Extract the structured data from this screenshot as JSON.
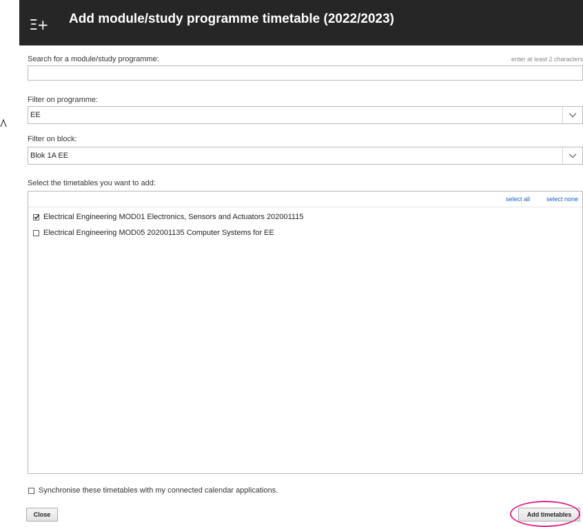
{
  "dialog": {
    "icon": "add-list-icon",
    "icon_glyph": "Ξ+",
    "title": "Add module/study programme timetable (2022/2023)"
  },
  "search": {
    "label": "Search for a module/study programme:",
    "hint": "enter at least 2 characters",
    "value": "",
    "placeholder": ""
  },
  "programme_filter": {
    "label": "Filter on programme:",
    "selected": "EE"
  },
  "block_filter": {
    "label": "Filter on block:",
    "selected": "Blok 1A EE"
  },
  "timetables": {
    "label": "Select the timetables you want to add:",
    "select_all": "select all",
    "select_none": "select none",
    "items": [
      {
        "label": "Electrical Engineering MOD01 Electronics, Sensors and Actuators 202001115",
        "checked": true
      },
      {
        "label": "Electrical Engineering MOD05 202001135 Computer Systems for EE",
        "checked": false
      }
    ]
  },
  "sync": {
    "label": "Synchronise these timetables with my connected calendar applications.",
    "checked": false
  },
  "buttons": {
    "close": "Close",
    "add": "Add timetables"
  },
  "colors": {
    "titlebar_bg": "#262626",
    "link": "#1a63b5",
    "highlight": "#e0268a"
  }
}
